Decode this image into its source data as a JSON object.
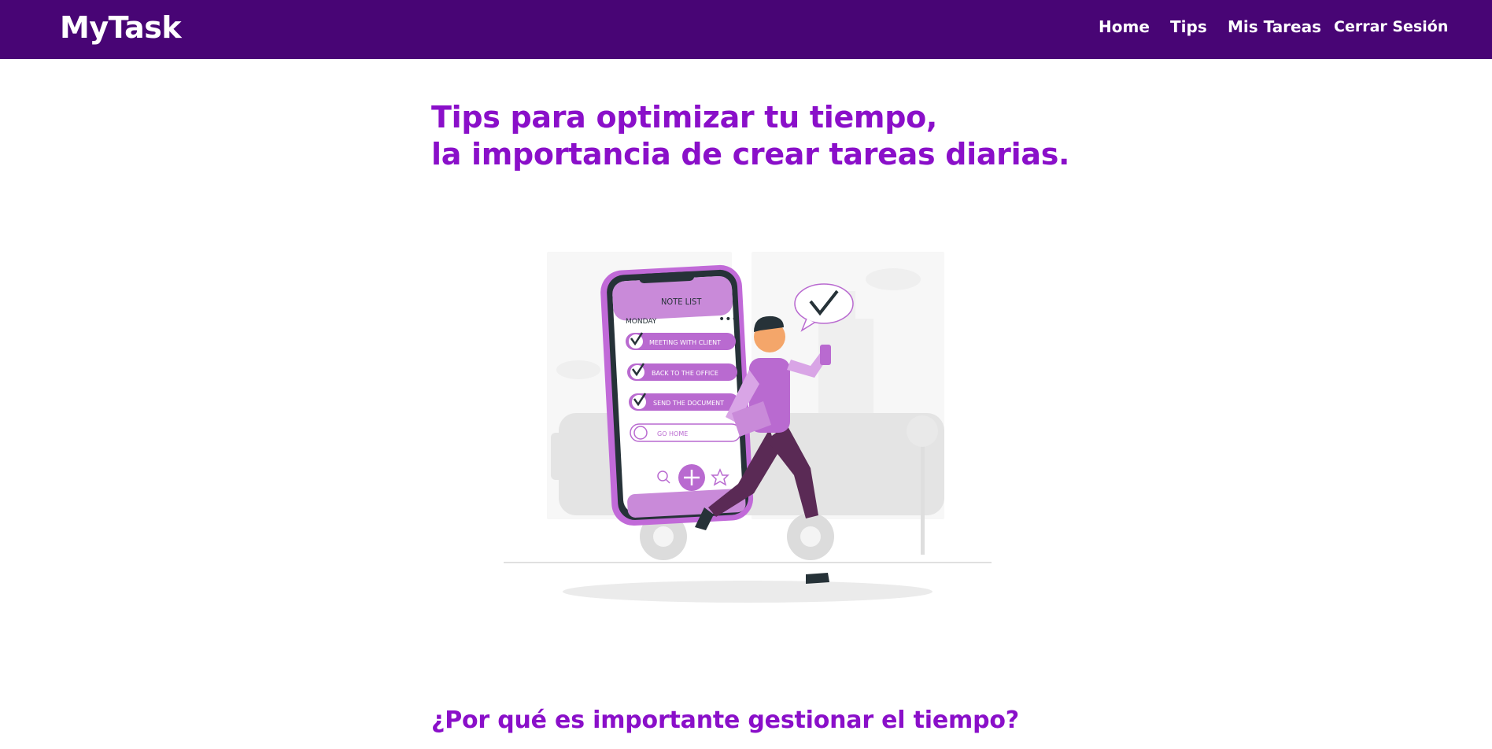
{
  "navbar": {
    "brand": "MyTask",
    "links": [
      {
        "label": "Home"
      },
      {
        "label": "Tips"
      },
      {
        "label": "Mis Tareas"
      },
      {
        "label": "Cerrar Sesión"
      }
    ],
    "background_color": "#480575"
  },
  "main": {
    "headline_lines": [
      "Tips para optimizar tu tiempo,",
      "la importancia de crear tareas diarias."
    ],
    "section_title": "¿Por qué es importante gestionar el tiempo?",
    "accent_color": "#8a0fc9"
  },
  "illustration": {
    "phone_title": "NOTE LIST",
    "day": "MONDAY",
    "tasks": [
      {
        "label": "MEETING WITH CLIENT",
        "done": true
      },
      {
        "label": "BACK TO THE OFFICE",
        "done": true
      },
      {
        "label": "SEND THE DOCUMENT",
        "done": true
      },
      {
        "label": "GO HOME",
        "done": false
      }
    ]
  }
}
